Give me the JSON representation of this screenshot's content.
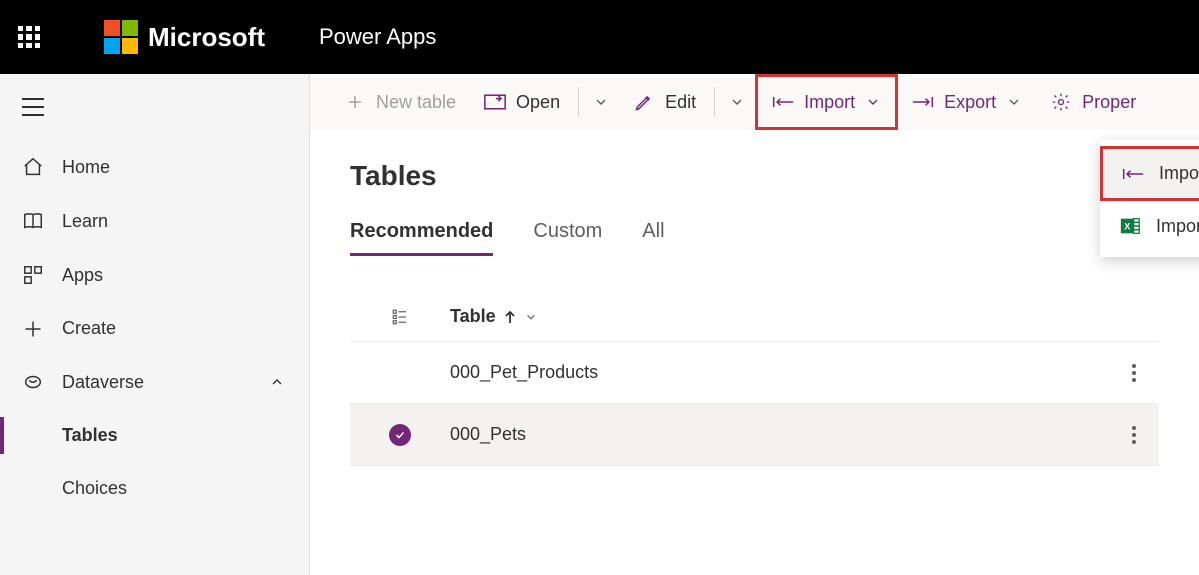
{
  "header": {
    "brand": "Microsoft",
    "app": "Power Apps"
  },
  "sidebar": {
    "items": [
      {
        "label": "Home"
      },
      {
        "label": "Learn"
      },
      {
        "label": "Apps"
      },
      {
        "label": "Create"
      },
      {
        "label": "Dataverse"
      }
    ],
    "dataverse_children": [
      {
        "label": "Tables"
      },
      {
        "label": "Choices"
      }
    ]
  },
  "commands": {
    "new_table": "New table",
    "open": "Open",
    "edit": "Edit",
    "import": "Import",
    "export": "Export",
    "properties": "Proper"
  },
  "import_menu": {
    "import_data": "Import data",
    "import_excel": "Import data from Excel"
  },
  "page": {
    "title": "Tables",
    "tabs": {
      "recommended": "Recommended",
      "custom": "Custom",
      "all": "All"
    }
  },
  "table": {
    "header_name": "Table",
    "rows": [
      {
        "name": "000_Pet_Products"
      },
      {
        "name": "000_Pets"
      }
    ]
  }
}
